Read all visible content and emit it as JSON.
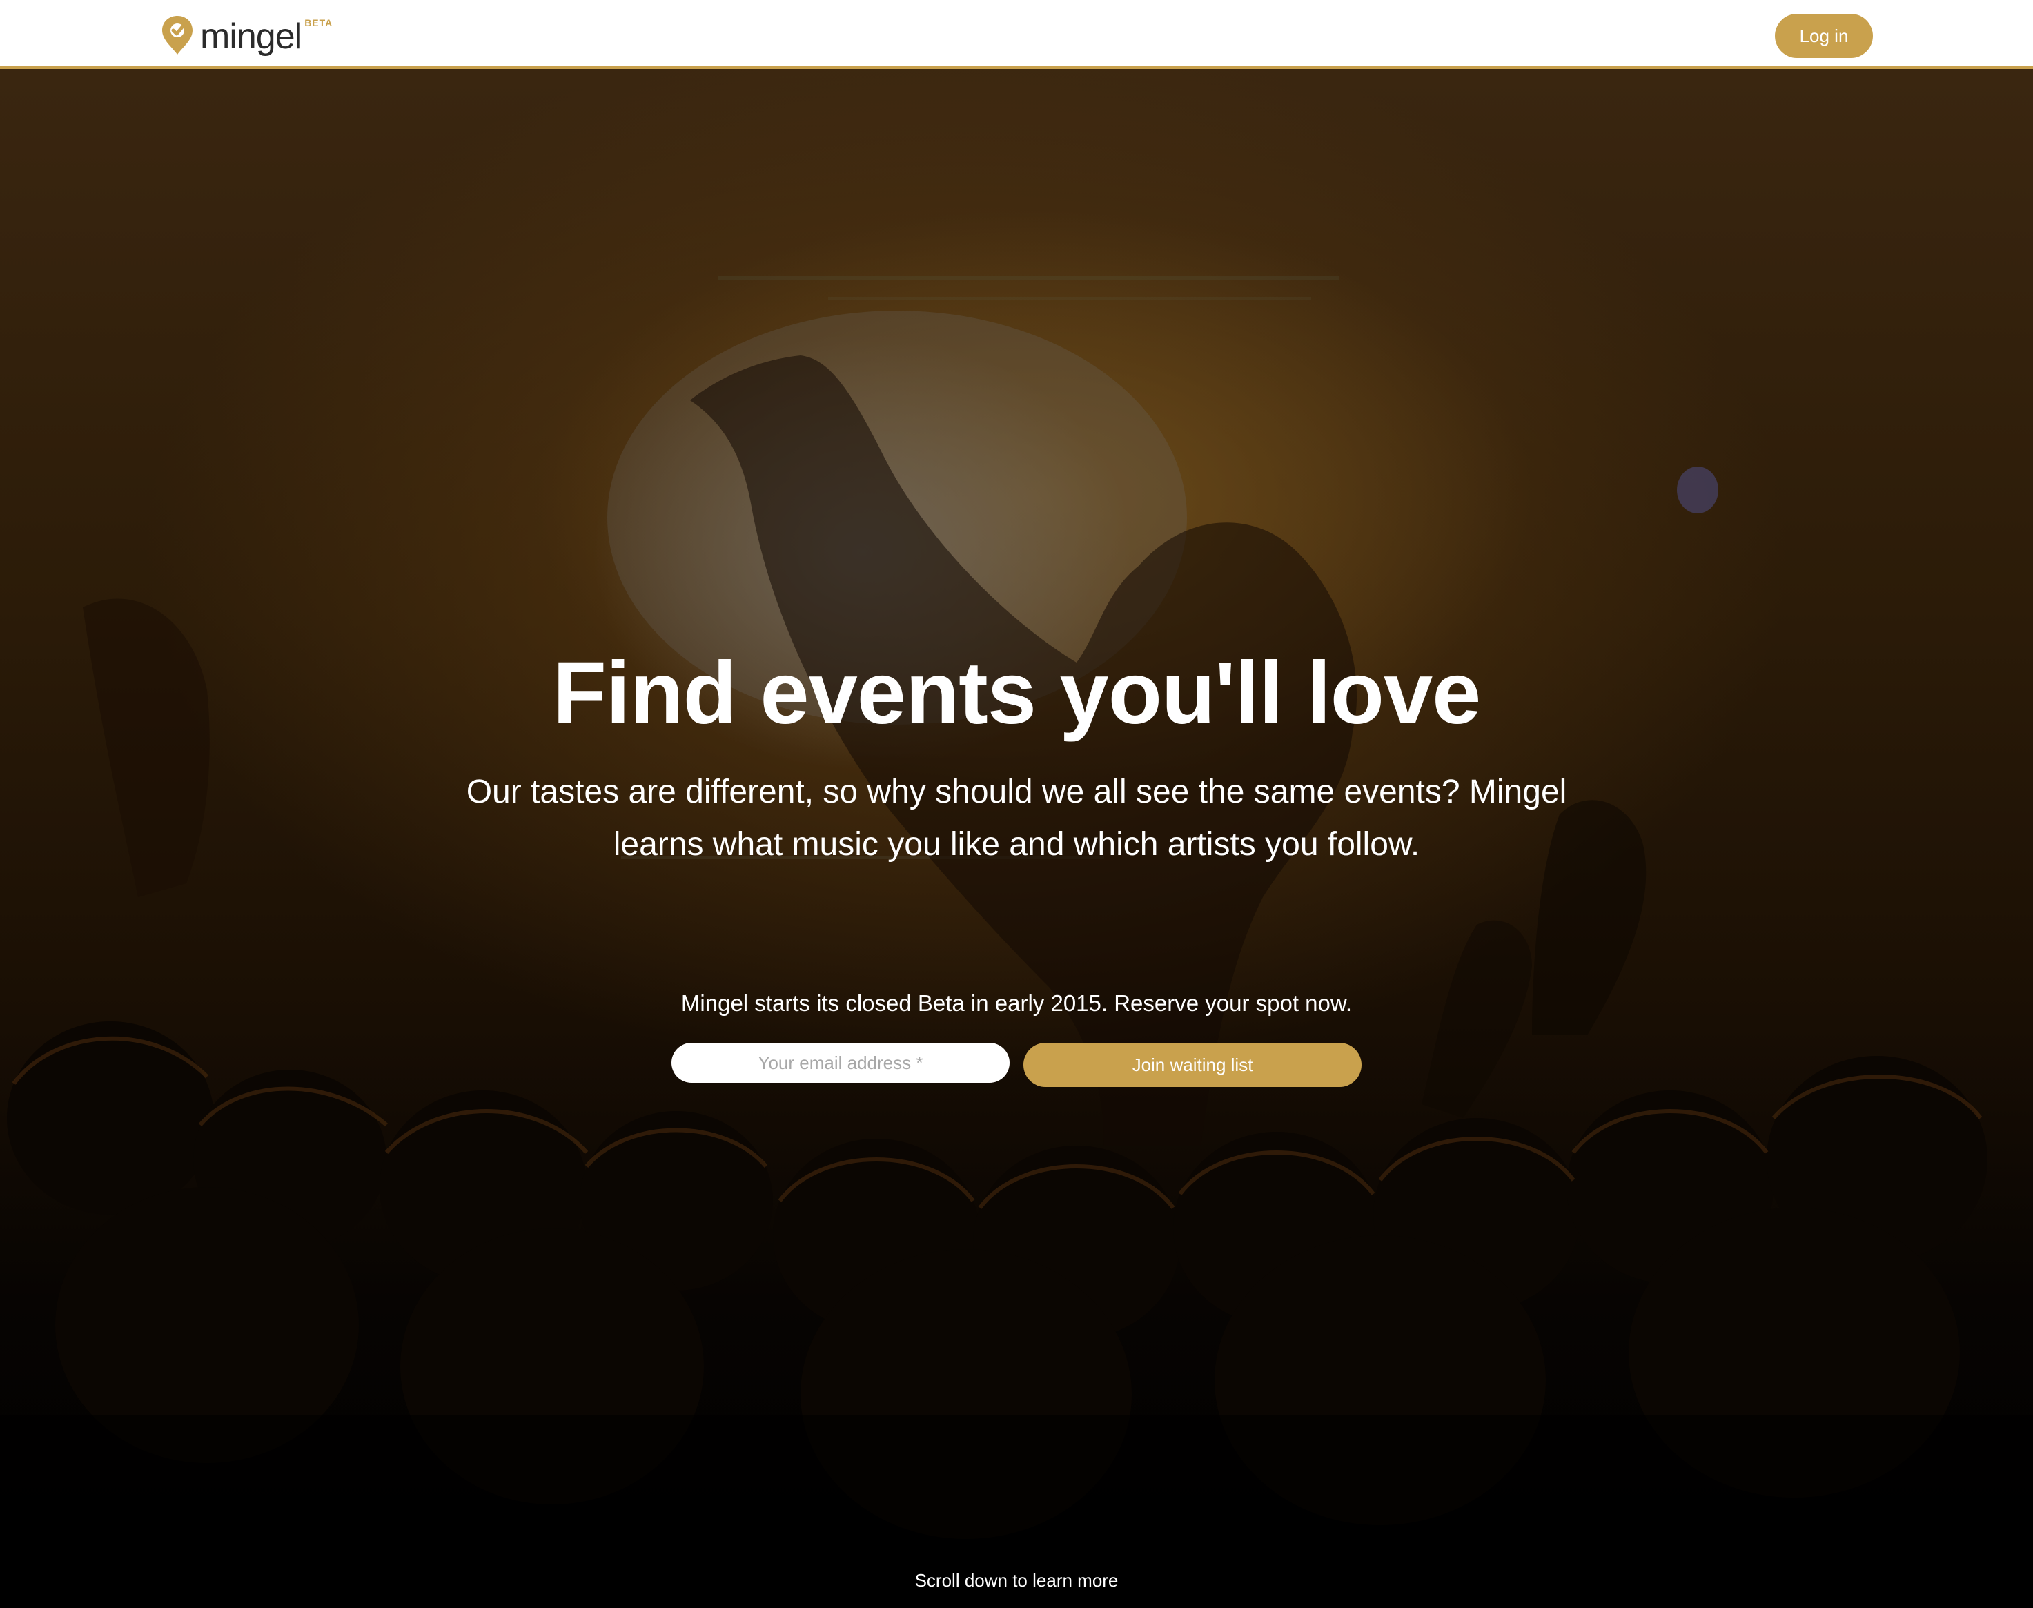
{
  "header": {
    "logo_text": "mingel",
    "logo_badge": "BETA",
    "login_label": "Log in"
  },
  "hero": {
    "headline": "Find events you'll love",
    "subline": "Our tastes are different, so why should we all see the same events? Mingel learns what music you like and which artists you follow.",
    "beta_note": "Mingel starts its closed Beta in early 2015. Reserve your spot now.",
    "email_placeholder": "Your email address *",
    "join_label": "Join waiting list",
    "scroll_hint": "Scroll down to learn more"
  },
  "colors": {
    "accent": "#c9a14d",
    "header_bg": "#ffffff",
    "hero_text": "#ffffff",
    "logo_text": "#2b2b2b"
  },
  "icons": {
    "logo_mark": "location-pin-check-icon"
  }
}
